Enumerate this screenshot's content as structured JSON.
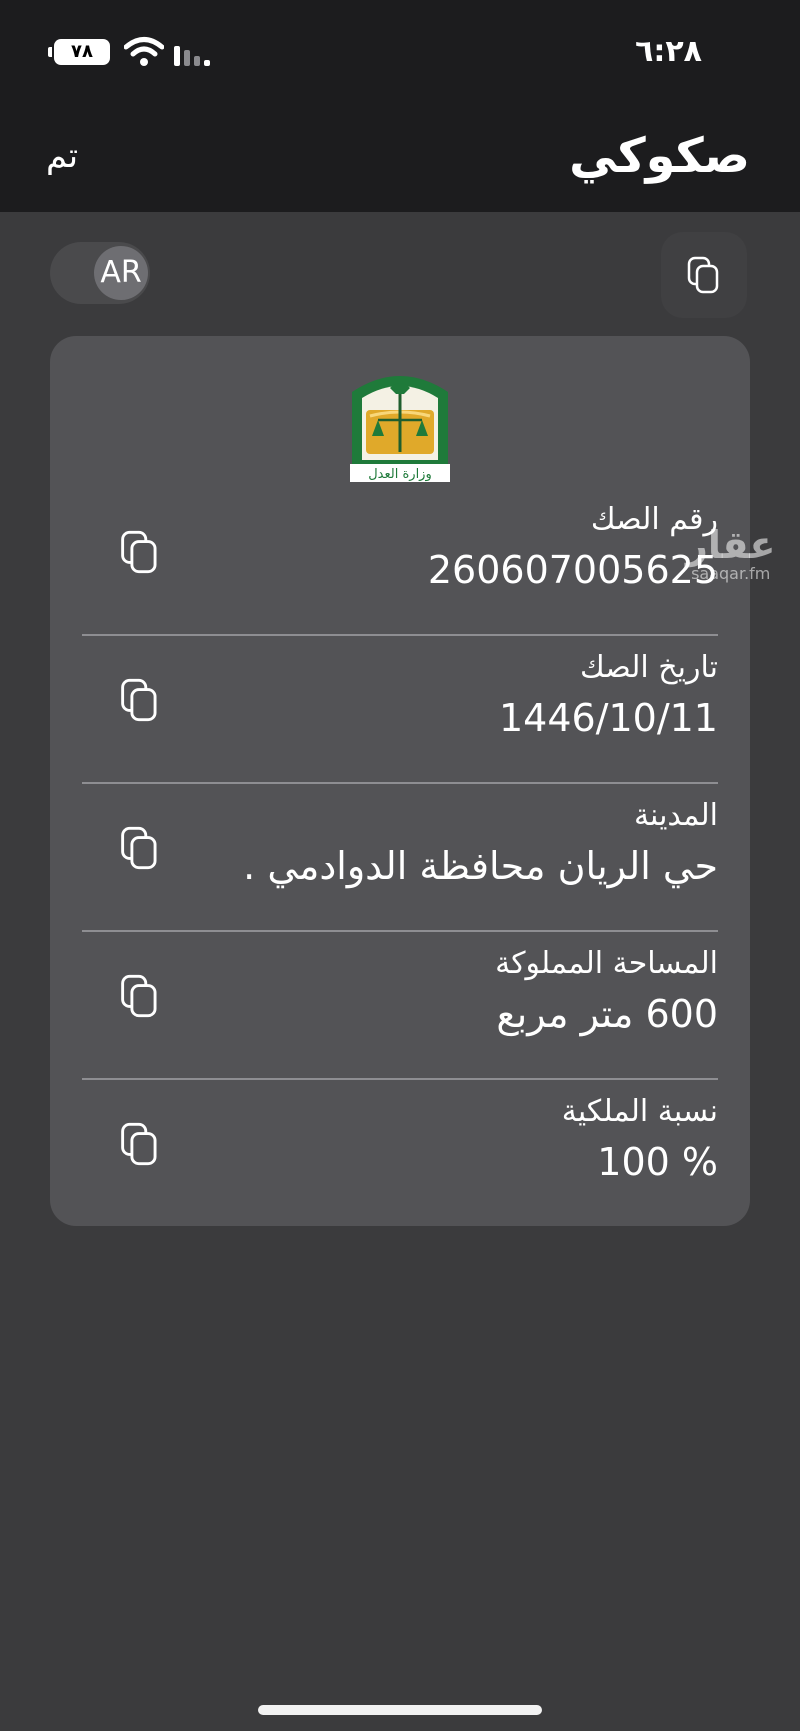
{
  "status_bar": {
    "time": "٦:٢٨",
    "battery": "٧٨"
  },
  "nav": {
    "title": "صكوكي",
    "done_label": "تم"
  },
  "toolbar": {
    "lang_toggle": "AR"
  },
  "card": {
    "emblem_caption": "وزارة العدل",
    "fields": [
      {
        "label": "رقم الصك",
        "value": "260607005625"
      },
      {
        "label": "تاريخ الصك",
        "value": "1446/10/11"
      },
      {
        "label": "المدينة",
        "value": "حي  الريان  محافظة الدوادمي ."
      },
      {
        "label": "المساحة المملوكة",
        "value": "600 متر مربع"
      },
      {
        "label": "نسبة الملكية",
        "value": "% 100"
      }
    ]
  },
  "watermark": {
    "brand": "عقار",
    "domain": "saaqar.fm"
  },
  "colors": {
    "background": "#3b3b3d",
    "nav_background": "#1c1c1e",
    "card_background": "#535356",
    "emblem_green": "#1f7a3a",
    "emblem_gold": "#e0a92a"
  }
}
